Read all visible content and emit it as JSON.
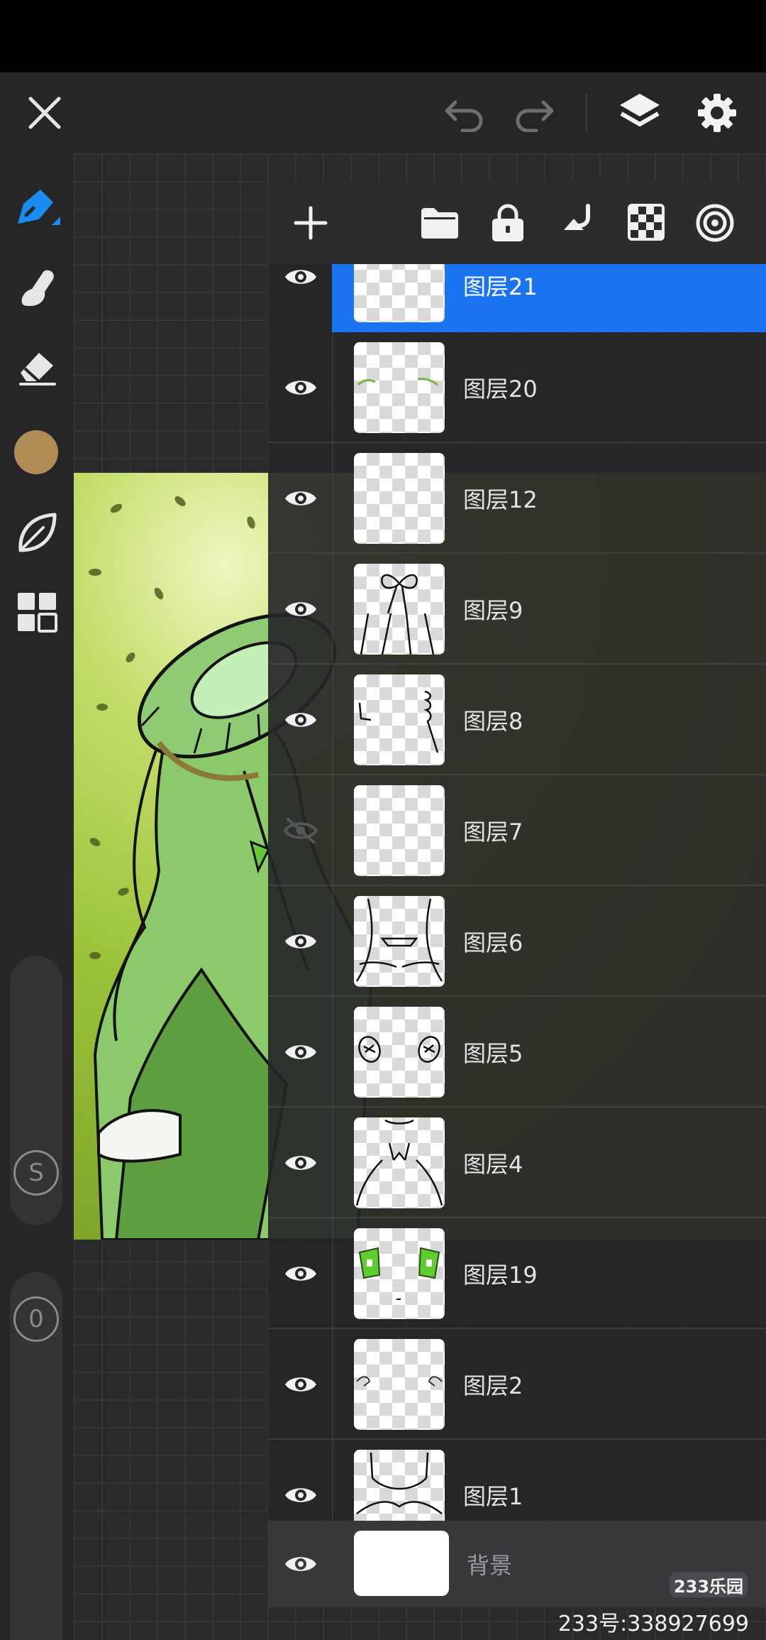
{
  "toolbar": {
    "close_icon": "close-icon",
    "undo_icon": "undo-icon",
    "redo_icon": "redo-icon",
    "layers_icon": "layers-icon",
    "settings_icon": "gear-icon"
  },
  "tools": {
    "items": [
      "pen-icon",
      "smudge-icon",
      "eraser-icon",
      "color-swatch",
      "leaf-icon",
      "grid-icon"
    ],
    "current_color": "#b08d57"
  },
  "sliders": {
    "size_label": "S",
    "opacity_label": "0"
  },
  "layer_panel": {
    "tools": [
      "add-layer-icon",
      "folder-icon",
      "lock-icon",
      "merge-down-icon",
      "checker-icon",
      "target-icon"
    ],
    "layers": [
      {
        "name": "图层21",
        "visible": true,
        "selected": true
      },
      {
        "name": "图层20",
        "visible": true,
        "selected": false
      },
      {
        "name": "图层12",
        "visible": true,
        "selected": false
      },
      {
        "name": "图层9",
        "visible": true,
        "selected": false
      },
      {
        "name": "图层8",
        "visible": true,
        "selected": false
      },
      {
        "name": "图层7",
        "visible": false,
        "selected": false
      },
      {
        "name": "图层6",
        "visible": true,
        "selected": false
      },
      {
        "name": "图层5",
        "visible": true,
        "selected": false
      },
      {
        "name": "图层4",
        "visible": true,
        "selected": false
      },
      {
        "name": "图层19",
        "visible": true,
        "selected": false
      },
      {
        "name": "图层2",
        "visible": true,
        "selected": false
      },
      {
        "name": "图层1",
        "visible": true,
        "selected": false
      }
    ],
    "background_label": "背景"
  },
  "colors": {
    "accent": "#1a74f0",
    "panel_bg": "#262628"
  },
  "watermark": {
    "badge": "233乐园",
    "id": "233号:338927699"
  }
}
